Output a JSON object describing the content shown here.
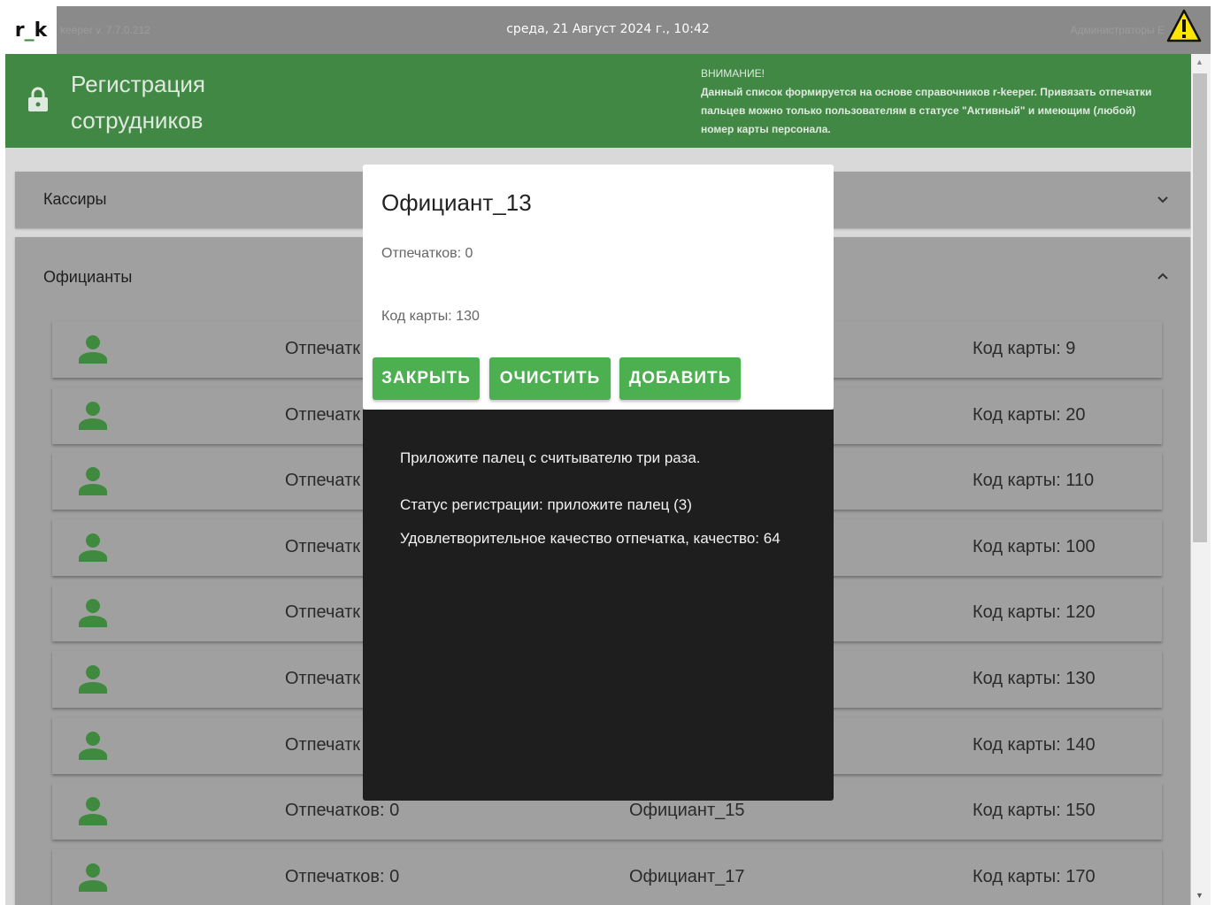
{
  "topbar": {
    "logo_text_left": "r",
    "logo_text_sep": "_",
    "logo_text_right": "k",
    "version": "keeper v. 7.7.0.212",
    "datetime": "среда, 21 Август 2024 г., 10:42",
    "user": "Администраторы Е",
    "warning_icon": "warning-triangle-icon"
  },
  "header": {
    "title_line1": "Регистрация",
    "title_line2": "сотрудников",
    "lock_icon": "lock-icon",
    "warning_title": "ВНИМАНИЕ!",
    "warning_text": "Данный список формируется на основе справочников r-keeper. Привязать отпечатки пальцев можно только пользователям в статусе \"Активный\" и имеющим (любой) номер карты персонала."
  },
  "groups": [
    {
      "title": "Кассиры",
      "expanded": false,
      "chevron": "chevron-down-icon"
    },
    {
      "title": "Официанты",
      "expanded": true,
      "chevron": "chevron-up-icon"
    }
  ],
  "employees": [
    {
      "prints": "Отпечатк",
      "name": "",
      "card": "Код карты: 9"
    },
    {
      "prints": "Отпечатк",
      "name": "",
      "card": "Код карты: 20"
    },
    {
      "prints": "Отпечатк",
      "name": "",
      "card": "Код карты: 110"
    },
    {
      "prints": "Отпечатк",
      "name": "",
      "card": "Код карты: 100"
    },
    {
      "prints": "Отпечатк",
      "name": "",
      "card": "Код карты: 120"
    },
    {
      "prints": "Отпечатк",
      "name": "",
      "card": "Код карты: 130"
    },
    {
      "prints": "Отпечатк",
      "name": "",
      "card": "Код карты: 140"
    },
    {
      "prints": "Отпечатков: 0",
      "name": "Официант_15",
      "card": "Код карты: 150"
    },
    {
      "prints": "Отпечатков: 0",
      "name": "Официант_17",
      "card": "Код карты: 170"
    }
  ],
  "dialog": {
    "title": "Официант_13",
    "prints": "Отпечатков: 0",
    "card": "Код карты: 130",
    "close_label": "ЗАКРЫТЬ",
    "clear_label": "ОЧИСТИТЬ",
    "add_label": "ДОБАВИТЬ"
  },
  "console": {
    "line1": "Приложите палец с считывателю три раза.",
    "line2": "Статус регистрации: приложите палец (3)",
    "line3": "Удовлетворительное качество отпечатка, качество: 64"
  },
  "colors": {
    "header_green": "#418844",
    "button_green": "#4caf50",
    "icon_green": "#3f8a3f",
    "console_bg": "#1e1e1e"
  }
}
